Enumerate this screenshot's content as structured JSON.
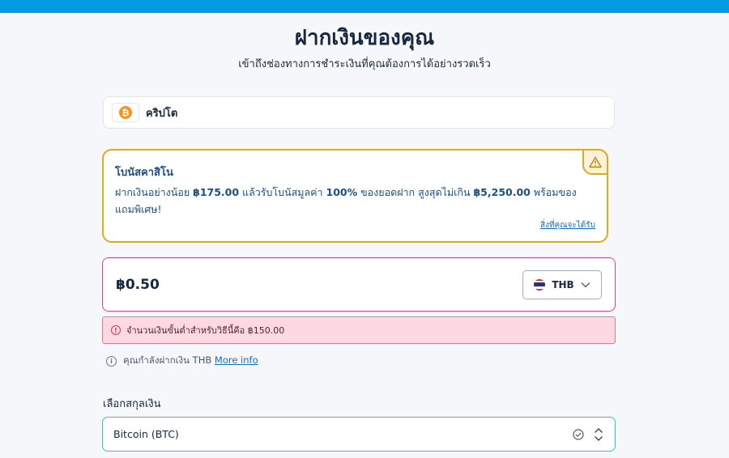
{
  "header": {
    "title": "ฝากเงินของคุณ",
    "subtitle": "เข้าถึงช่องทางการชำระเงินที่คุณต้องการได้อย่างรวดเร็ว"
  },
  "method": {
    "icon": "bitcoin-icon",
    "coin_glyph": "₿",
    "label": "คริปโต"
  },
  "bonus": {
    "title": "โบนัสคาสิโน",
    "text_1": "ฝากเงินอย่างน้อย ",
    "min_amount": "฿175.00",
    "text_2": " แล้วรับโบนัสมูลค่า ",
    "percent": "100%",
    "text_3": " ของยอดฝาก สูงสุดไม่เกิน ",
    "max_amount": "฿5,250.00",
    "text_4": " พร้อมของแถมพิเศษ!",
    "link": "สิ่งที่คุณจะได้รับ",
    "warning_icon": "warning-triangle-icon"
  },
  "amount": {
    "value": "฿0.50",
    "currency": "THB",
    "currency_icon": "thailand-flag-icon",
    "chevron_icon": "chevron-down-icon"
  },
  "error": {
    "icon": "exclamation-circle-icon",
    "glyph": "!",
    "text": "จำนวนเงินขั้นต่ำสำหรับวิธีนี้คือ ฿150.00"
  },
  "info": {
    "icon": "info-circle-icon",
    "glyph": "i",
    "text": "คุณกำลังฝากเงิน THB",
    "link": "More info"
  },
  "currency_select": {
    "label": "เลือกสกุลเงิน",
    "value": "Bitcoin (BTC)",
    "check_icon": "check-circle-icon",
    "updown_icon": "chevron-updown-icon"
  },
  "colors": {
    "topbar": "#049be5",
    "bonus_border": "#e0a91e",
    "error_border": "#e0477a",
    "select_border": "#36c9a3",
    "link": "#1a6cc4"
  }
}
